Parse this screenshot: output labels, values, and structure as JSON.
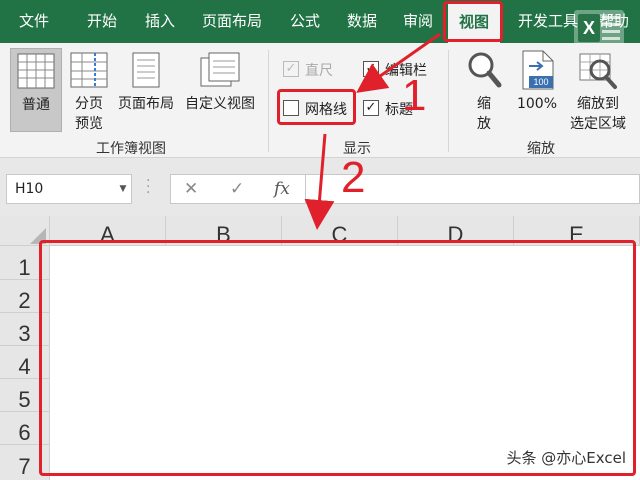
{
  "ribbon_tabs": [
    {
      "label": "文件"
    },
    {
      "label": "开始"
    },
    {
      "label": "插入"
    },
    {
      "label": "页面布局"
    },
    {
      "label": "公式"
    },
    {
      "label": "数据"
    },
    {
      "label": "审阅"
    },
    {
      "label": "视图",
      "active": true
    },
    {
      "label": "开发工具"
    },
    {
      "label": "帮助"
    }
  ],
  "workbook_views": {
    "group_label": "工作簿视图",
    "normal": "普通",
    "page_break_l1": "分页",
    "page_break_l2": "预览",
    "page_layout": "页面布局",
    "custom_views": "自定义视图"
  },
  "show": {
    "group_label": "显示",
    "ruler": {
      "label": "直尺",
      "checked": true,
      "enabled": false
    },
    "formula_bar": {
      "label": "编辑栏",
      "checked": true
    },
    "gridlines": {
      "label": "网格线",
      "checked": false
    },
    "headings": {
      "label": "标题",
      "checked": true
    }
  },
  "zoom": {
    "group_label": "缩放",
    "zoom_l1": "缩",
    "zoom_l2": "放",
    "hundred": "100%",
    "hundred_badge": "100",
    "zoom_sel_l1": "缩放到",
    "zoom_sel_l2": "选定区域"
  },
  "formula_bar": {
    "name_box": "H10",
    "fx": "fx",
    "cancel_glyph": "✕",
    "enter_glyph": "✓"
  },
  "grid": {
    "columns": [
      "A",
      "B",
      "C",
      "D",
      "E"
    ],
    "rows": [
      "1",
      "2",
      "3",
      "4",
      "5",
      "6",
      "7"
    ]
  },
  "annotations": {
    "step1": "1",
    "step2": "2"
  },
  "watermark": "头条 @亦心Excel",
  "badge_letter": "X",
  "colors": {
    "excel_green": "#217346",
    "annotation_red": "#e0202a"
  }
}
